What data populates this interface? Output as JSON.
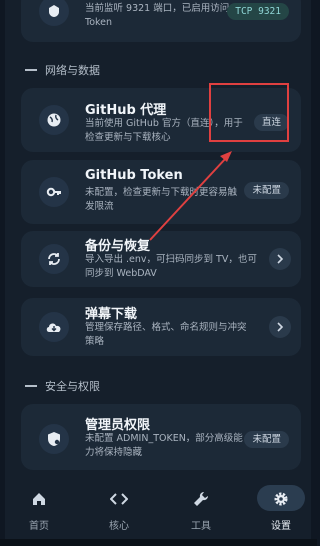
{
  "top_card": {
    "desc": "当前监听 9321 端口，已启用访问 Token",
    "badge": "TCP 9321"
  },
  "sections": {
    "network": "网络与数据",
    "security": "安全与权限"
  },
  "items": [
    {
      "title": "GitHub 代理",
      "desc": "当前使用 GitHub 官方（直连），用于检查更新与下载核心",
      "badge": "直连"
    },
    {
      "title": "GitHub Token",
      "desc": "未配置，检查更新与下载时更容易触发限流",
      "badge": "未配置"
    },
    {
      "title": "备份与恢复",
      "desc": "导入导出 .env，可扫码同步到 TV，也可同步到 WebDAV"
    },
    {
      "title": "弹幕下载",
      "desc": "管理保存路径、格式、命名规则与冲突策略"
    },
    {
      "title": "管理员权限",
      "desc": "未配置 ADMIN_TOKEN，部分高级能力将保持隐藏",
      "badge": "未配置"
    }
  ],
  "nav": [
    {
      "label": "首页",
      "icon": "home-icon"
    },
    {
      "label": "核心",
      "icon": "code-icon"
    },
    {
      "label": "工具",
      "icon": "wrench-icon"
    },
    {
      "label": "设置",
      "icon": "gear-icon",
      "active": true
    }
  ],
  "colors": {
    "accent": "#2b3d50",
    "annotation": "#e04040"
  }
}
